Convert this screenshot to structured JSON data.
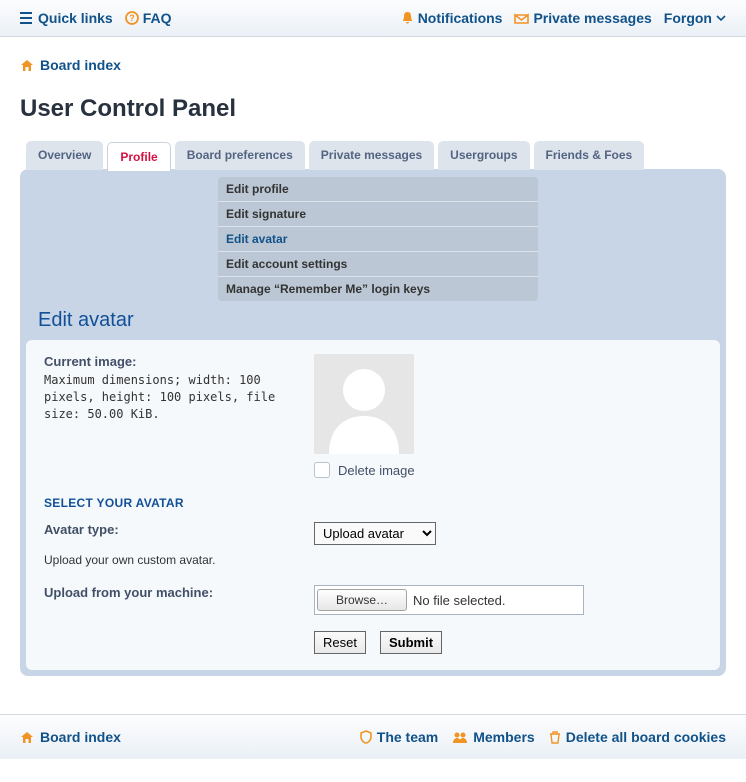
{
  "topbar": {
    "quick_links": "Quick links",
    "faq": "FAQ",
    "notifications": "Notifications",
    "pm": "Private messages",
    "username": "Forgon"
  },
  "breadcrumb": {
    "board_index": "Board index"
  },
  "page_title": "User Control Panel",
  "tabs": [
    {
      "label": "Overview",
      "active": false
    },
    {
      "label": "Profile",
      "active": true
    },
    {
      "label": "Board preferences",
      "active": false
    },
    {
      "label": "Private messages",
      "active": false
    },
    {
      "label": "Usergroups",
      "active": false
    },
    {
      "label": "Friends & Foes",
      "active": false
    }
  ],
  "subnav": [
    {
      "label": "Edit profile",
      "active": false
    },
    {
      "label": "Edit signature",
      "active": false
    },
    {
      "label": "Edit avatar",
      "active": true
    },
    {
      "label": "Edit account settings",
      "active": false
    },
    {
      "label": "Manage “Remember Me” login keys",
      "active": false
    }
  ],
  "section_title": "Edit avatar",
  "current_image": {
    "label": "Current image:",
    "desc": "Maximum dimensions; width: 100 pixels, height: 100 pixels, file size: 50.00 KiB.",
    "delete_label": "Delete image"
  },
  "select_header": "SELECT YOUR AVATAR",
  "avatar_type": {
    "label": "Avatar type:",
    "selected": "Upload avatar",
    "hint": "Upload your own custom avatar."
  },
  "upload": {
    "label": "Upload from your machine:",
    "browse": "Browse…",
    "status": "No file selected."
  },
  "buttons": {
    "reset": "Reset",
    "submit": "Submit"
  },
  "footer": {
    "board_index": "Board index",
    "team": "The team",
    "members": "Members",
    "delete_cookies": "Delete all board cookies"
  }
}
